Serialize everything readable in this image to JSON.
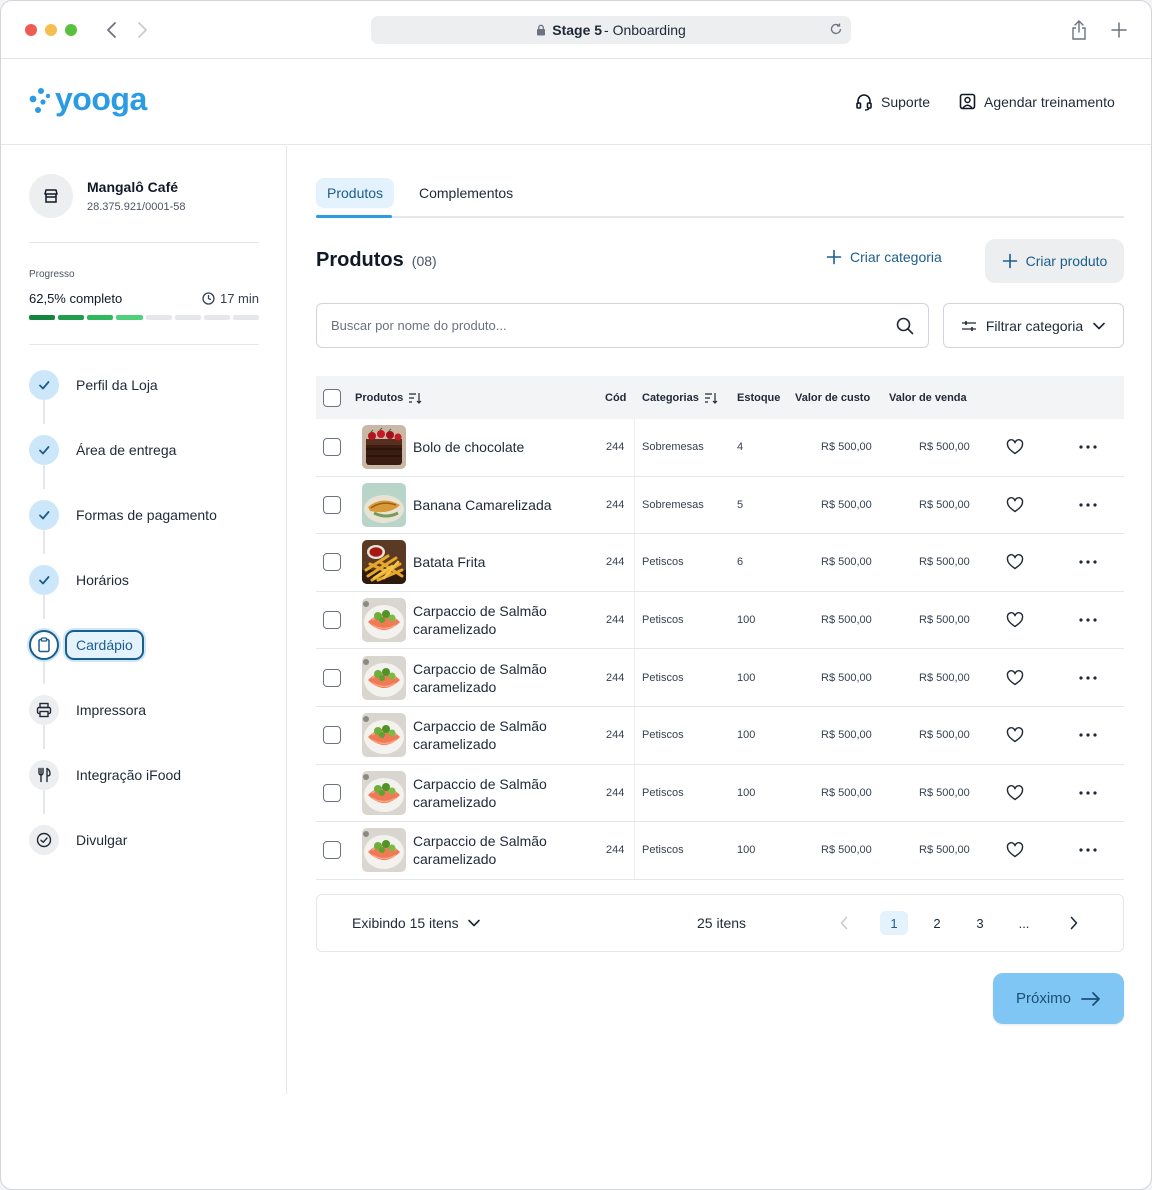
{
  "browser": {
    "url_bold": "Stage 5",
    "url_rest": "- Onboarding"
  },
  "header": {
    "logo_text": "yooga",
    "support_label": "Suporte",
    "training_label": "Agendar treinamento"
  },
  "sidebar": {
    "store_name": "Mangalô Café",
    "store_cnpj": "28.375.921/0001-58",
    "progress_label": "Progresso",
    "progress_text": "62,5% completo",
    "progress_fraction": 0.5,
    "progress_time": "17 min",
    "steps": [
      {
        "label": "Perfil da Loja",
        "status": "done",
        "icon": "check-icon"
      },
      {
        "label": "Área de entrega",
        "status": "done",
        "icon": "check-icon"
      },
      {
        "label": "Formas de pagamento",
        "status": "done",
        "icon": "check-icon"
      },
      {
        "label": "Horários",
        "status": "done",
        "icon": "check-icon"
      },
      {
        "label": "Cardápio",
        "status": "active",
        "icon": "clipboard-icon"
      },
      {
        "label": "Impressora",
        "status": "todo",
        "icon": "printer-icon"
      },
      {
        "label": "Integração iFood",
        "status": "todo",
        "icon": "fork-knife-icon"
      },
      {
        "label": "Divulgar",
        "status": "todo",
        "icon": "check-circle-icon"
      }
    ]
  },
  "main": {
    "tabs": [
      {
        "label": "Produtos",
        "active": true
      },
      {
        "label": "Complementos",
        "active": false
      }
    ],
    "title": "Produtos",
    "count": "(08)",
    "create_category": "Criar categoria",
    "create_product": "Criar produto",
    "search_placeholder": "Buscar por nome do produto...",
    "filter_label": "Filtrar categoria",
    "columns": {
      "product": "Produtos",
      "code": "Cód",
      "category": "Categorias",
      "stock": "Estoque",
      "cost": "Valor de custo",
      "price": "Valor de venda"
    },
    "rows": [
      {
        "name": "Bolo de chocolate",
        "img": "cake",
        "code": "244",
        "category": "Sobremesas",
        "stock": "4",
        "cost": "R$ 500,00",
        "price": "R$ 500,00"
      },
      {
        "name": "Banana Camarelizada",
        "img": "banana",
        "code": "244",
        "category": "Sobremesas",
        "stock": "5",
        "cost": "R$ 500,00",
        "price": "R$ 500,00"
      },
      {
        "name": "Batata Frita",
        "img": "fries",
        "code": "244",
        "category": "Petiscos",
        "stock": "6",
        "cost": "R$ 500,00",
        "price": "R$ 500,00"
      },
      {
        "name": "Carpaccio de Salmão caramelizado",
        "img": "salmon",
        "code": "244",
        "category": "Petiscos",
        "stock": "100",
        "cost": "R$ 500,00",
        "price": "R$ 500,00"
      },
      {
        "name": "Carpaccio de Salmão caramelizado",
        "img": "salmon",
        "code": "244",
        "category": "Petiscos",
        "stock": "100",
        "cost": "R$ 500,00",
        "price": "R$ 500,00"
      },
      {
        "name": "Carpaccio de Salmão caramelizado",
        "img": "salmon",
        "code": "244",
        "category": "Petiscos",
        "stock": "100",
        "cost": "R$ 500,00",
        "price": "R$ 500,00"
      },
      {
        "name": "Carpaccio de Salmão caramelizado",
        "img": "salmon",
        "code": "244",
        "category": "Petiscos",
        "stock": "100",
        "cost": "R$ 500,00",
        "price": "R$ 500,00"
      },
      {
        "name": "Carpaccio de Salmão caramelizado",
        "img": "salmon",
        "code": "244",
        "category": "Petiscos",
        "stock": "100",
        "cost": "R$ 500,00",
        "price": "R$ 500,00"
      }
    ],
    "pagination": {
      "showing": "Exibindo 15 itens",
      "total": "25 itens",
      "pages": [
        "1",
        "2",
        "3",
        "..."
      ],
      "current": "1"
    },
    "next_label": "Próximo"
  },
  "colors": {
    "brand": "#2b9be3",
    "primary_dark": "#1b5e8c",
    "primary_light": "#e3f2fd",
    "next_button": "#7fc6f5"
  }
}
